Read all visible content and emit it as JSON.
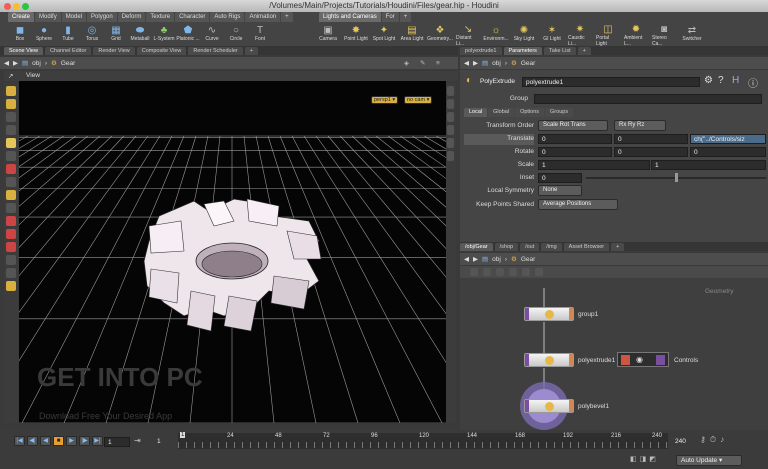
{
  "window": {
    "title": "/Volumes/Main/Projects/Tutorials/Houdini/Files/gear.hip - Houdini"
  },
  "shelf_left": {
    "tabs": [
      "Create",
      "Modify",
      "Model",
      "Polygon",
      "Deform",
      "Texture",
      "Character",
      "Auto Rigs",
      "Animation",
      "+"
    ],
    "tools": [
      {
        "label": "Box",
        "icon": "box-icon"
      },
      {
        "label": "Sphere",
        "icon": "sphere-icon"
      },
      {
        "label": "Tube",
        "icon": "tube-icon"
      },
      {
        "label": "Torus",
        "icon": "torus-icon"
      },
      {
        "label": "Grid",
        "icon": "grid-icon"
      },
      {
        "label": "Metaball",
        "icon": "metaball-icon"
      },
      {
        "label": "L-System",
        "icon": "lsystem-icon"
      },
      {
        "label": "Platonic ...",
        "icon": "platonic-icon"
      },
      {
        "label": "Curve",
        "icon": "curve-icon"
      },
      {
        "label": "Circle",
        "icon": "circle-icon"
      },
      {
        "label": "Font",
        "icon": "font-icon"
      }
    ]
  },
  "shelf_right": {
    "tabs": [
      "Lights and Cameras",
      "For",
      "+"
    ],
    "tools": [
      {
        "label": "Camera",
        "icon": "camera-icon"
      },
      {
        "label": "Point Light",
        "icon": "point-light-icon"
      },
      {
        "label": "Spot Light",
        "icon": "spot-light-icon"
      },
      {
        "label": "Area Light",
        "icon": "area-light-icon"
      },
      {
        "label": "Geometry...",
        "icon": "geometry-light-icon"
      },
      {
        "label": "Distant Li...",
        "icon": "distant-light-icon"
      },
      {
        "label": "Environm...",
        "icon": "environment-light-icon"
      },
      {
        "label": "Sky Light",
        "icon": "sky-light-icon"
      },
      {
        "label": "GI Light",
        "icon": "gi-light-icon"
      },
      {
        "label": "Caustic Li...",
        "icon": "caustic-light-icon"
      },
      {
        "label": "Portal Light",
        "icon": "portal-light-icon"
      },
      {
        "label": "Ambient L...",
        "icon": "ambient-light-icon"
      },
      {
        "label": "Stereo Ca...",
        "icon": "stereo-camera-icon"
      },
      {
        "label": "Switcher",
        "icon": "switcher-icon"
      }
    ]
  },
  "left_pane": {
    "tabs": [
      "Scene View",
      "Channel Editor",
      "Render View",
      "Composite View",
      "Render Scheduler",
      "+"
    ],
    "path": [
      "obj",
      "Gear"
    ],
    "view_label": "View",
    "camera_menu": "persp1",
    "cam_menu": "no cam"
  },
  "watermark": {
    "main": "GET INTO PC",
    "sub": "Download Free Your Desired App"
  },
  "right_top": {
    "tabs": [
      "polyextrude1",
      "Parameters",
      "Take List",
      "+"
    ],
    "path": [
      "obj",
      "Gear"
    ],
    "node_type": "PolyExtrude",
    "node_name": "polyextrude1",
    "group_label": "Group",
    "group_value": "",
    "subtabs": [
      "Local",
      "Global",
      "Options",
      "Groups"
    ],
    "params": {
      "transform_order_label": "Transform Order",
      "transform_order": "Scale Rot Trans",
      "rot_order": "Rx Ry Rz",
      "translate_label": "Translate",
      "translate": [
        "0",
        "0",
        "ch(\"../Controls/siz"
      ],
      "rotate_label": "Rotate",
      "rotate": [
        "0",
        "0",
        "0"
      ],
      "scale_label": "Scale",
      "scale": [
        "1",
        "1",
        ""
      ],
      "inset_label": "Inset",
      "inset": "0",
      "local_symmetry_label": "Local Symmetry",
      "local_symmetry": "None",
      "keep_points_label": "Keep Points Shared",
      "keep_points": "Average Positions"
    }
  },
  "right_bottom": {
    "tabs": [
      "/obj/Gear",
      "/shop",
      "/out",
      "/img",
      "Asset Browser",
      "+"
    ],
    "path": [
      "obj",
      "Gear"
    ],
    "context_label": "Geometry",
    "nodes": [
      {
        "name": "group1"
      },
      {
        "name": "polyextrude1"
      },
      {
        "name": "polybevel1"
      }
    ],
    "controls_label": "Controls"
  },
  "timeline": {
    "current_frame": "1",
    "start": "1",
    "step": "1",
    "ticks": [
      "1",
      "24",
      "48",
      "72",
      "96",
      "120",
      "144",
      "168",
      "192",
      "216",
      "240"
    ],
    "end_frame": "240",
    "auto_update": "Auto Update"
  }
}
